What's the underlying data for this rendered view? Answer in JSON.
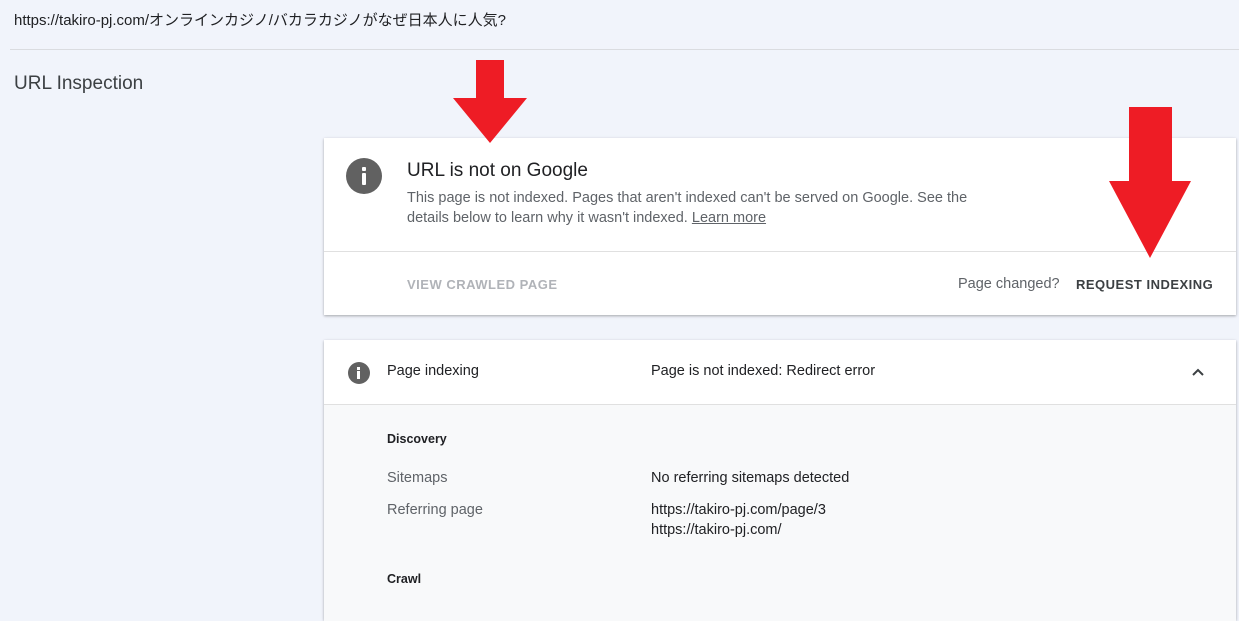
{
  "url_bar": {
    "url": "https://takiro-pj.com/オンラインカジノ/バカラカジノがなぜ日本人に人気?"
  },
  "page": {
    "title": "URL Inspection"
  },
  "status_card": {
    "title": "URL is not on Google",
    "description": "This page is not indexed. Pages that aren't indexed can't be served on Google. See the details below to learn why it wasn't indexed.",
    "learn_more": "Learn more",
    "view_crawled_page": "VIEW CRAWLED PAGE",
    "page_changed": "Page changed?",
    "request_indexing": "REQUEST INDEXING"
  },
  "indexing_card": {
    "label": "Page indexing",
    "value": "Page is not indexed: Redirect error",
    "discovery": {
      "heading": "Discovery",
      "sitemaps_label": "Sitemaps",
      "sitemaps_value": "No referring sitemaps detected",
      "referring_label": "Referring page",
      "referring_values": [
        "https://takiro-pj.com/page/3",
        "https://takiro-pj.com/"
      ]
    },
    "crawl": {
      "heading": "Crawl"
    }
  },
  "colors": {
    "annotation_arrow": "#ee1c25",
    "icon_gray": "#616161",
    "background": "#f1f4fb"
  },
  "icons": [
    "info-icon",
    "chevron-up-icon",
    "red-arrow-annotation"
  ]
}
